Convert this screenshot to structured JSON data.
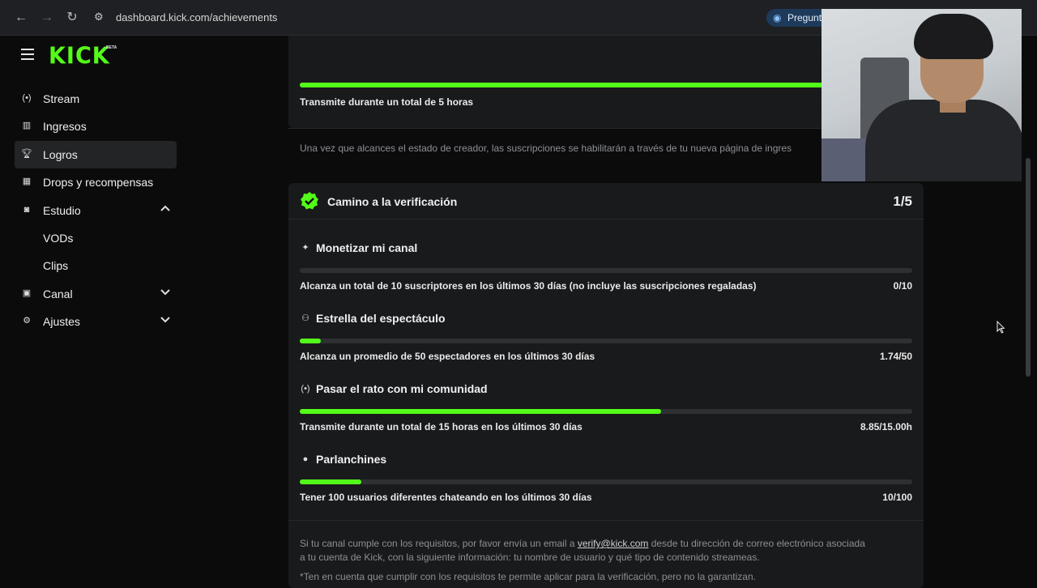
{
  "browser": {
    "url": "dashboard.kick.com/achievements",
    "ask_label": "Pregunt"
  },
  "sidebar": {
    "logo": "KICK",
    "logo_badge": "BETA",
    "items": [
      {
        "label": "Stream"
      },
      {
        "label": "Ingresos"
      },
      {
        "label": "Logros"
      },
      {
        "label": "Drops y recompensas"
      },
      {
        "label": "Estudio"
      },
      {
        "label": "VODs"
      },
      {
        "label": "Clips"
      },
      {
        "label": "Canal"
      },
      {
        "label": "Ajustes"
      }
    ]
  },
  "top_card": {
    "task": "Transmite durante un total de 5 horas",
    "progress": 1.0,
    "note": "Una vez que alcances el estado de creador, las suscripciones se habilitarán a través de tu nueva página de ingres"
  },
  "verification": {
    "title": "Camino a la verificación",
    "count": "1/5",
    "sections": [
      {
        "title": "Monetizar mi canal",
        "task": "Alcanza un total de 10 suscriptores en los últimos 30 días (no incluye las suscripciones regaladas)",
        "value": "0/10",
        "progress": 0.0
      },
      {
        "title": "Estrella del espectáculo",
        "task": "Alcanza un promedio de 50 espectadores en los últimos 30 días",
        "value": "1.74/50",
        "progress": 0.035
      },
      {
        "title": "Pasar el rato con mi comunidad",
        "task": "Transmite durante un total de 15 horas en los últimos 30 días",
        "value": "8.85/15.00h",
        "progress": 0.59
      },
      {
        "title": "Parlanchines",
        "task": "Tener 100 usuarios diferentes chateando en los últimos 30 días",
        "value": "10/100",
        "progress": 0.1
      }
    ],
    "footer_1a": "Si tu canal cumple con los requisitos, por favor envía un email a ",
    "footer_email": "verify@kick.com",
    "footer_1b": " desde tu dirección de correo electrónico asociada",
    "footer_2": "a tu cuenta de Kick, con la siguiente información: tu nombre de usuario y qué tipo de contenido streameas.",
    "footer_3": "*Ten en cuenta que cumplir con los requisitos te permite aplicar para la verificación, pero no la garantizan."
  },
  "colors": {
    "accent": "#53fc18",
    "track": "#2e3033",
    "card": "#191a1c"
  }
}
